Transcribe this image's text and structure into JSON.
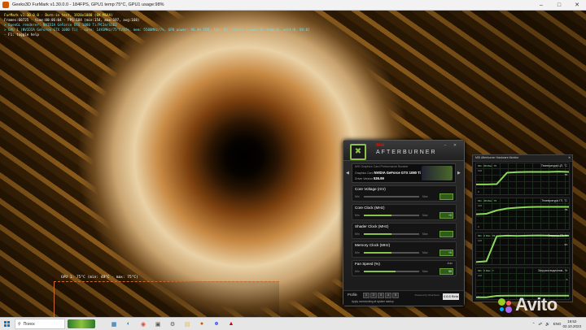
{
  "window": {
    "title": "Geeks3D FurMark v1.30.0.0 - 184FPS, GPU1 temp:75°C, GPU1 usage:98%"
  },
  "osd": {
    "lines": [
      {
        "text": "FurMark v1.30.0.0 - Burn-in test, 1920x1080 (0X MSAA)",
        "color": "y"
      },
      {
        "text": "Frames:60725 - time:00:06:04 - FPS:184 (min:154, max:197, avg:168)",
        "color": "w"
      },
      {
        "text": "> OpenGL renderer: NVIDIA GeForce GTX 1080 Ti/PCIe/SSE2",
        "color": "c"
      },
      {
        "text": "> GPU 1 (NVIDIA GeForce GTX 1080 Ti) - core: 1493MHz/75°C/97%, mem: 5508MHz/7%, GPU power: 96.4% TDP, fan: 0%, limits:[power:0, temp:0, volt:0, OV:0]",
        "color": "c"
      },
      {
        "text": "- F1: toggle help",
        "color": "w"
      }
    ],
    "graph_label": "GPU 1: 75°C (min: 48°C - max: 75°C)"
  },
  "afterburner": {
    "brand": "msi",
    "name": "AFTERBURNER",
    "gpu_label": "Graphics Card",
    "gpu_name": "NVIDIA GeForce GTX 1080 Ti",
    "driver_label": "Driver Version",
    "driver_version": "536.99",
    "panel_caption": "MSI Graphics Card Performance Booster",
    "sliders": [
      {
        "label": "Core Voltage (mV)",
        "min": "Min",
        "max": "Max",
        "value": "",
        "fill": 0.0
      },
      {
        "label": "Core Clock (MHz)",
        "min": "Min",
        "max": "Max",
        "value": "+0",
        "fill": 0.5
      },
      {
        "label": "Shader Clock (MHz)",
        "min": "Min",
        "max": "Max",
        "value": "",
        "fill": 0.5
      },
      {
        "label": "Memory Clock (MHz)",
        "min": "Min",
        "max": "Max",
        "value": "+0",
        "fill": 0.5
      },
      {
        "label": "Fan Speed (%)",
        "min": "Min",
        "max": "Max",
        "value": "58",
        "fill": 0.58,
        "auto": "Auto"
      }
    ],
    "profile_label": "Profile",
    "profile_slots": [
      "1",
      "2",
      "3",
      "4",
      "5"
    ],
    "apply_text": "Apply overclocking at system startup",
    "version": "4.6.6 Beta 2",
    "powered": "Powered by RivaTuner"
  },
  "monitor": {
    "title": "MSI Afterburner Hardware Monitor",
    "graphs": [
      {
        "label": "Температура ЦП, °С",
        "min": "Min : 38  Max : 75",
        "ymax": "100",
        "ymin": "0",
        "current": "75",
        "points": [
          0.3,
          0.3,
          0.31,
          0.72,
          0.74,
          0.75,
          0.75,
          0.75,
          0.76,
          0.75
        ]
      },
      {
        "label": "Температура ГП, °С",
        "min": "Min : 48  Max : 75",
        "ymax": "100",
        "ymin": "0",
        "current": "75",
        "points": [
          0.48,
          0.5,
          0.62,
          0.69,
          0.72,
          0.74,
          0.75,
          0.75,
          0.75,
          0.75
        ]
      },
      {
        "label": "Загрузка ГП, %",
        "min": "Min : 0  Max : 99",
        "ymax": "100",
        "ymin": "0",
        "current": "97",
        "points": [
          0.02,
          0.05,
          0.95,
          0.97,
          0.96,
          0.97,
          0.98,
          0.97,
          0.96,
          0.97
        ]
      },
      {
        "label": "Загрузка видеопам., %",
        "min": "Min : 0  Max : 7",
        "ymax": "100",
        "ymin": "0",
        "current": "7",
        "points": [
          0.01,
          0.01,
          0.06,
          0.07,
          0.07,
          0.07,
          0.07,
          0.07,
          0.07,
          0.07
        ]
      }
    ]
  },
  "taskbar": {
    "search_placeholder": "Поиск",
    "apps": [
      "file-explorer-icon",
      "edge-icon",
      "chrome-icon",
      "store-icon",
      "settings-icon",
      "folder-icon",
      "furmark-icon",
      "discord-icon",
      "afterburner-icon"
    ],
    "lang": "ENG",
    "time": "19:52",
    "date": "02.10.2023"
  },
  "watermark": {
    "text": "Avito"
  },
  "colors": {
    "accent": "#8bc34a",
    "osd_yellow": "#ffff55",
    "osd_cyan": "#55e6ff",
    "graph_line": "#8bd85a"
  }
}
